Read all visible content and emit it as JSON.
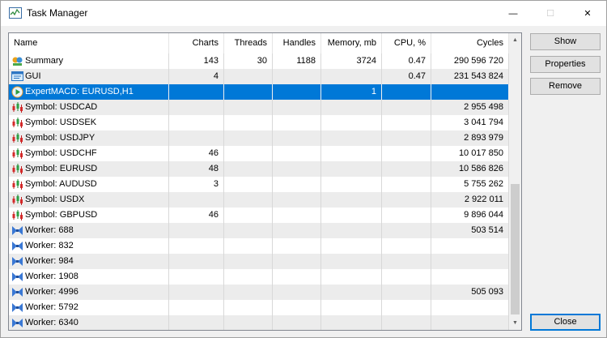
{
  "window": {
    "title": "Task Manager",
    "min_glyph": "—",
    "max_glyph": "☐",
    "close_glyph": "✕"
  },
  "columns": [
    {
      "key": "name",
      "label": "Name"
    },
    {
      "key": "charts",
      "label": "Charts"
    },
    {
      "key": "threads",
      "label": "Threads"
    },
    {
      "key": "handles",
      "label": "Handles"
    },
    {
      "key": "memory",
      "label": "Memory, mb"
    },
    {
      "key": "cpu",
      "label": "CPU, %"
    },
    {
      "key": "cycles",
      "label": "Cycles"
    }
  ],
  "rows": [
    {
      "icon": "summary-icon",
      "name": "Summary",
      "charts": "143",
      "threads": "30",
      "handles": "1188",
      "memory": "3724",
      "cpu": "0.47",
      "cycles": "290 596 720"
    },
    {
      "icon": "gui-icon",
      "name": "GUI",
      "charts": "4",
      "threads": "",
      "handles": "",
      "memory": "",
      "cpu": "0.47",
      "cycles": "231 543 824"
    },
    {
      "icon": "expert-icon",
      "name": "ExpertMACD: EURUSD,H1",
      "charts": "",
      "threads": "",
      "handles": "",
      "memory": "1",
      "cpu": "",
      "cycles": "",
      "selected": true
    },
    {
      "icon": "symbol-chart-icon",
      "name": "Symbol: USDCAD",
      "charts": "",
      "threads": "",
      "handles": "",
      "memory": "",
      "cpu": "",
      "cycles": "2 955 498"
    },
    {
      "icon": "symbol-chart-icon",
      "name": "Symbol: USDSEK",
      "charts": "",
      "threads": "",
      "handles": "",
      "memory": "",
      "cpu": "",
      "cycles": "3 041 794"
    },
    {
      "icon": "symbol-chart-icon",
      "name": "Symbol: USDJPY",
      "charts": "",
      "threads": "",
      "handles": "",
      "memory": "",
      "cpu": "",
      "cycles": "2 893 979"
    },
    {
      "icon": "symbol-chart-icon",
      "name": "Symbol: USDCHF",
      "charts": "46",
      "threads": "",
      "handles": "",
      "memory": "",
      "cpu": "",
      "cycles": "10 017 850"
    },
    {
      "icon": "symbol-chart-icon",
      "name": "Symbol: EURUSD",
      "charts": "48",
      "threads": "",
      "handles": "",
      "memory": "",
      "cpu": "",
      "cycles": "10 586 826"
    },
    {
      "icon": "symbol-chart-icon",
      "name": "Symbol: AUDUSD",
      "charts": "3",
      "threads": "",
      "handles": "",
      "memory": "",
      "cpu": "",
      "cycles": "5 755 262"
    },
    {
      "icon": "symbol-chart-icon",
      "name": "Symbol: USDX",
      "charts": "",
      "threads": "",
      "handles": "",
      "memory": "",
      "cpu": "",
      "cycles": "2 922 011"
    },
    {
      "icon": "symbol-chart-icon",
      "name": "Symbol: GBPUSD",
      "charts": "46",
      "threads": "",
      "handles": "",
      "memory": "",
      "cpu": "",
      "cycles": "9 896 044"
    },
    {
      "icon": "worker-icon",
      "name": "Worker: 688",
      "charts": "",
      "threads": "",
      "handles": "",
      "memory": "",
      "cpu": "",
      "cycles": "503 514"
    },
    {
      "icon": "worker-icon",
      "name": "Worker: 832",
      "charts": "",
      "threads": "",
      "handles": "",
      "memory": "",
      "cpu": "",
      "cycles": ""
    },
    {
      "icon": "worker-icon",
      "name": "Worker: 984",
      "charts": "",
      "threads": "",
      "handles": "",
      "memory": "",
      "cpu": "",
      "cycles": ""
    },
    {
      "icon": "worker-icon",
      "name": "Worker: 1908",
      "charts": "",
      "threads": "",
      "handles": "",
      "memory": "",
      "cpu": "",
      "cycles": ""
    },
    {
      "icon": "worker-icon",
      "name": "Worker: 4996",
      "charts": "",
      "threads": "",
      "handles": "",
      "memory": "",
      "cpu": "",
      "cycles": "505 093"
    },
    {
      "icon": "worker-icon",
      "name": "Worker: 5792",
      "charts": "",
      "threads": "",
      "handles": "",
      "memory": "",
      "cpu": "",
      "cycles": ""
    },
    {
      "icon": "worker-icon",
      "name": "Worker: 6340",
      "charts": "",
      "threads": "",
      "handles": "",
      "memory": "",
      "cpu": "",
      "cycles": ""
    }
  ],
  "buttons": {
    "show": "Show",
    "properties": "Properties",
    "remove": "Remove",
    "close": "Close"
  },
  "colors": {
    "selection": "#0078d7",
    "alt_row": "#ececec"
  }
}
